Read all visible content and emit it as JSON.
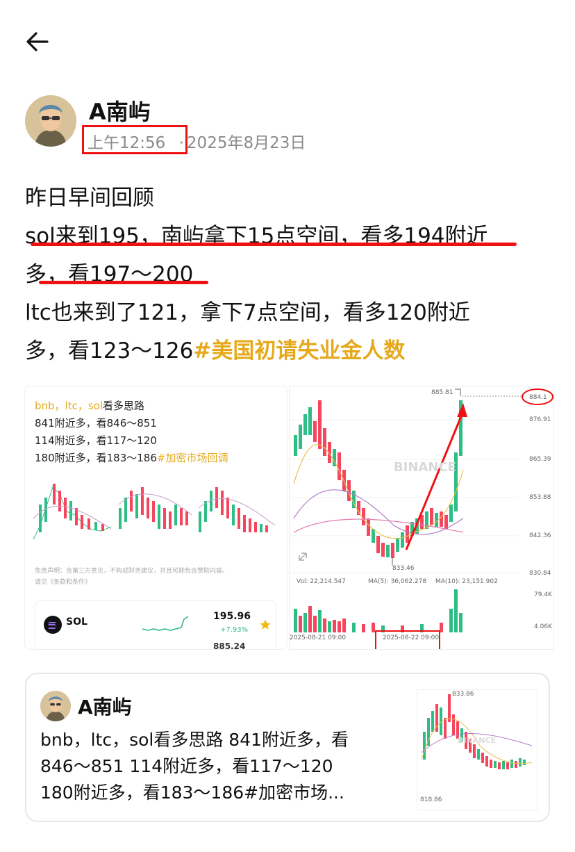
{
  "nav": {
    "back_icon": "arrow-left-icon"
  },
  "post": {
    "author": "A南屿",
    "time": "上午12:56",
    "date_separator": "·",
    "date": "2025年8月23日",
    "lines": [
      "昨日早间回顾",
      "sol来到195，南屿拿下15点空间，看多194附近",
      "多，看197～200",
      "ltc也来到了121，拿下7点空间，看多120附近"
    ],
    "last_line_text": "多，看123～126",
    "hashtag": "#美国初请失业金人数"
  },
  "image1": {
    "title_a": "bnb，ltc，sol",
    "title_b": "看多思路",
    "line1": "841附近多，看846～851",
    "line2": "114附近多，看117～120",
    "line3_a": "180附近多，看183～186",
    "line3_tag": "#加密市场回调",
    "disclaimer1": "免责声明：含第三方意见，不构成财务建议，并且可能包含赞助内容。",
    "disclaimer2": "请见《条款和条件》",
    "ticker": {
      "symbol": "SOL",
      "price": "195.96",
      "change": "+7.93%",
      "next_price": "885.24"
    }
  },
  "image2": {
    "watermark": "BINANCE",
    "price_high": "885.81",
    "price_marked": "884.1",
    "axis_labels": [
      "876.91",
      "865.39",
      "853.88",
      "842.36",
      "830.84"
    ],
    "low_label": "833.46",
    "vol_label": "Vol: 22,214.547",
    "ma5_label": "MA(5): 36,062.278",
    "ma10_label": "MA(10): 23,151.902",
    "vol_axis_top": "79.4K",
    "vol_axis_bottom": "4.06K",
    "date_left": "2025-08-21 09:00",
    "date_right": "2025-08-22 09:00"
  },
  "quote_card": {
    "author": "A南屿",
    "lines": [
      "bnb，ltc，sol看多思路 841附近多，看",
      "846～851 114附近多，看117～120",
      "180附近多，看183～186#加密市场..."
    ],
    "thumb_high": "833.86",
    "thumb_low": "818.86"
  },
  "colors": {
    "accent_red": "#e11111",
    "hashtag_gold": "#e6a91b",
    "up_green": "#2ebd85",
    "down_red": "#f6465d"
  }
}
